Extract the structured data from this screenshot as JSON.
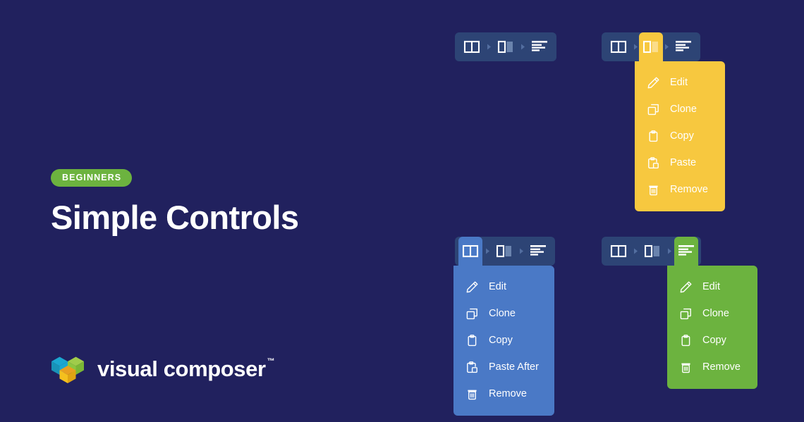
{
  "page": {
    "background_color": "#21215e",
    "badge_color": "#6cb33f",
    "title_color": "#ffffff"
  },
  "hero": {
    "badge": "BEGINNERS",
    "title": "Simple Controls"
  },
  "logo": {
    "name": "visual composer",
    "trademark": "™",
    "cube_colors": {
      "blue": "#1ba7d0",
      "green": "#8cc63f",
      "orange_left": "#e8a020",
      "orange_right": "#c8821a",
      "yellow_bottom": "#f4c01e"
    }
  },
  "widgets": [
    {
      "id": "toolbar-default",
      "name": "row-column-element-toolbar",
      "state": "default",
      "bar_color": "#2d4475",
      "segments": [
        {
          "icon": "row-icon",
          "label": "Row",
          "state": "normal"
        },
        {
          "icon": "column-icon",
          "label": "Column",
          "state": "normal"
        },
        {
          "icon": "element-icon",
          "label": "Element",
          "state": "normal"
        }
      ],
      "menu": null
    },
    {
      "id": "toolbar-column-open",
      "name": "column-controls-toolbar",
      "state": "column-menu-open",
      "bar_color": "#2d4475",
      "accent_color": "#f7c83f",
      "segments": [
        {
          "icon": "row-icon",
          "label": "Row",
          "state": "normal"
        },
        {
          "icon": "column-icon",
          "label": "Column",
          "state": "active"
        },
        {
          "icon": "element-icon",
          "label": "Element",
          "state": "normal"
        }
      ],
      "menu": {
        "color": "#f7c83f",
        "items": [
          {
            "icon": "pencil-icon",
            "label": "Edit"
          },
          {
            "icon": "clone-icon",
            "label": "Clone"
          },
          {
            "icon": "copy-icon",
            "label": "Copy"
          },
          {
            "icon": "paste-icon",
            "label": "Paste"
          },
          {
            "icon": "trash-icon",
            "label": "Remove"
          }
        ]
      }
    },
    {
      "id": "toolbar-row-open",
      "name": "row-controls-toolbar",
      "state": "row-menu-open",
      "bar_color": "#2d4475",
      "accent_color": "#4a79c6",
      "segments": [
        {
          "icon": "row-icon",
          "label": "Row",
          "state": "active"
        },
        {
          "icon": "column-icon",
          "label": "Column",
          "state": "normal"
        },
        {
          "icon": "element-icon",
          "label": "Element",
          "state": "normal"
        }
      ],
      "menu": {
        "color": "#4a79c6",
        "items": [
          {
            "icon": "pencil-icon",
            "label": "Edit"
          },
          {
            "icon": "clone-icon",
            "label": "Clone"
          },
          {
            "icon": "copy-icon",
            "label": "Copy"
          },
          {
            "icon": "paste-icon",
            "label": "Paste After"
          },
          {
            "icon": "trash-icon",
            "label": "Remove"
          }
        ]
      }
    },
    {
      "id": "toolbar-element-open",
      "name": "element-controls-toolbar",
      "state": "element-menu-open",
      "bar_color": "#2d4475",
      "accent_color": "#6cb33f",
      "segments": [
        {
          "icon": "row-icon",
          "label": "Row",
          "state": "normal"
        },
        {
          "icon": "column-icon",
          "label": "Column",
          "state": "normal"
        },
        {
          "icon": "element-icon",
          "label": "Element",
          "state": "active"
        }
      ],
      "menu": {
        "color": "#6cb33f",
        "items": [
          {
            "icon": "pencil-icon",
            "label": "Edit"
          },
          {
            "icon": "clone-icon",
            "label": "Clone"
          },
          {
            "icon": "copy-icon",
            "label": "Copy"
          },
          {
            "icon": "trash-icon",
            "label": "Remove"
          }
        ]
      }
    }
  ]
}
